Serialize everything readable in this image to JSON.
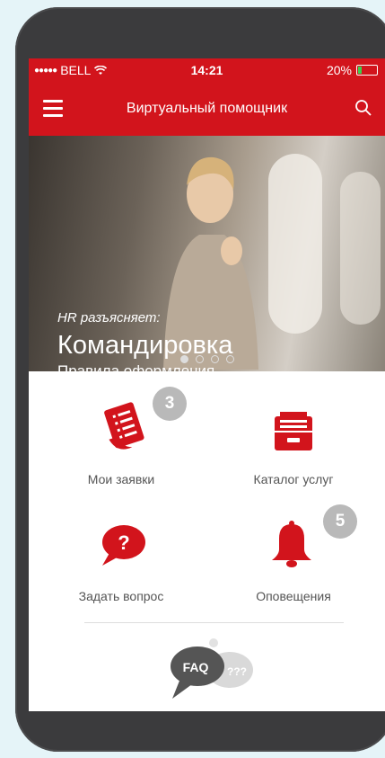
{
  "status_bar": {
    "carrier": "BELL",
    "time": "14:21",
    "battery": "20%",
    "battery_level": 0.2
  },
  "nav": {
    "title": "Виртуальный помощник"
  },
  "banner": {
    "kicker": "HR разъясняет:",
    "headline": "Командировка",
    "subtitle": "Правила оформления",
    "pages": 4,
    "active_page": 0
  },
  "tiles": [
    {
      "label": "Мои заявки",
      "icon": "document-icon",
      "badge": "3"
    },
    {
      "label": "Каталог услуг",
      "icon": "drawer-icon",
      "badge": ""
    },
    {
      "label": "Задать вопрос",
      "icon": "question-bubble-icon",
      "badge": ""
    },
    {
      "label": "Оповещения",
      "icon": "bell-icon",
      "badge": "5"
    }
  ],
  "faq": {
    "label": "FAQ",
    "bubble_text": "???"
  },
  "colors": {
    "brand": "#d2141c",
    "badge": "#b9b9b9",
    "text": "#555555",
    "background": "#e5f4f8",
    "frame": "#3b3b3d"
  }
}
